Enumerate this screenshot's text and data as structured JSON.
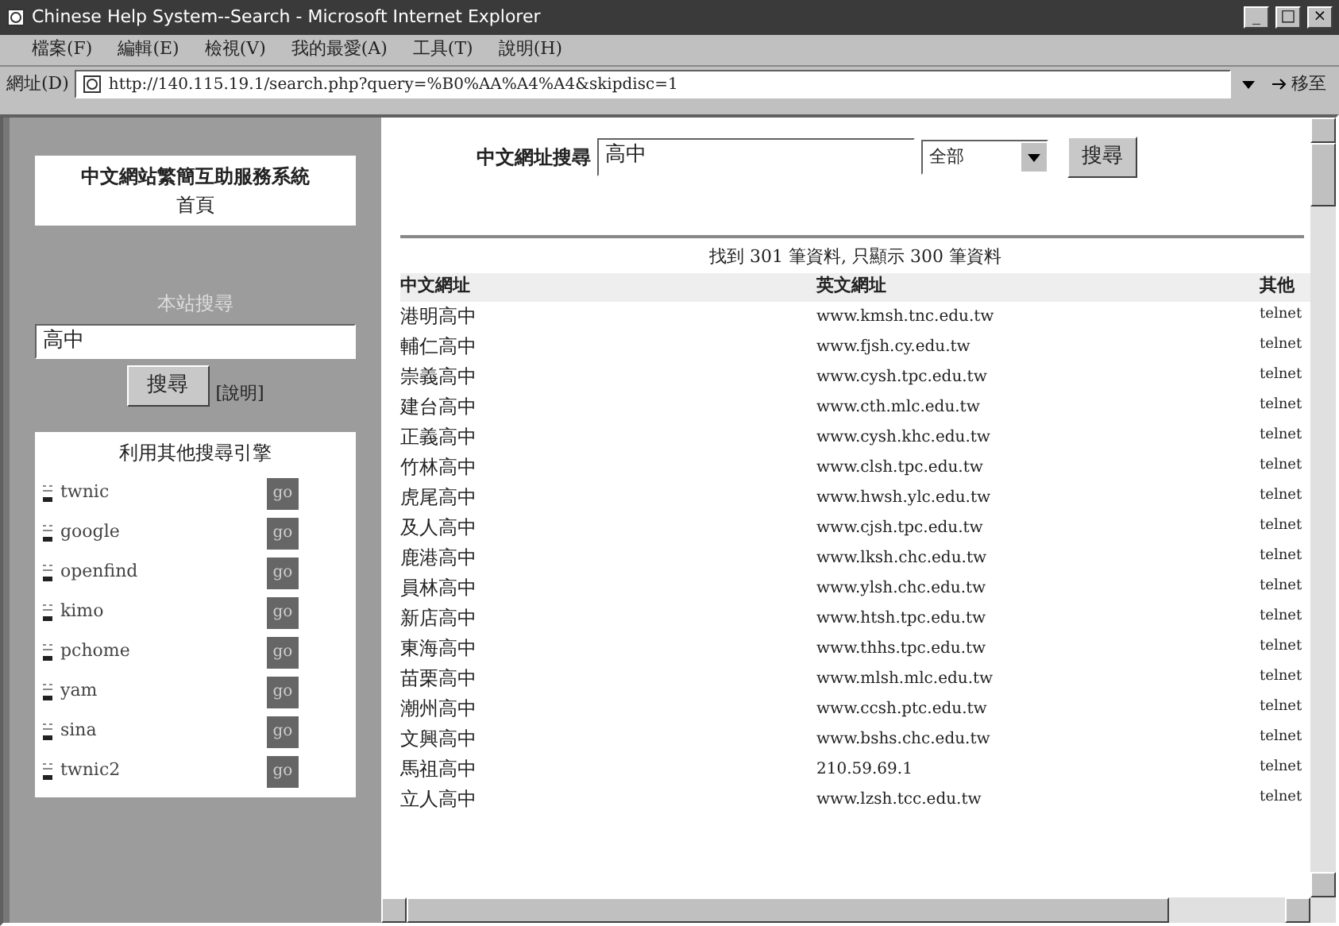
{
  "window": {
    "title": "Chinese Help System--Search - Microsoft Internet Explorer",
    "controls": [
      "_",
      "□",
      "×"
    ]
  },
  "menu": [
    "檔案(F)",
    "編輯(E)",
    "檢視(V)",
    "我的最愛(A)",
    "工具(T)",
    "說明(H)"
  ],
  "address_bar": {
    "label": "網址(D)",
    "value": "http://140.115.19.1/search.php?query=%B0%AA%A4%A4&skipdisc=1",
    "go": "移至"
  },
  "sidebar": {
    "site_title": "中文網站繁簡互助服務系統",
    "home_link": "首頁",
    "search_heading": "本站搜尋",
    "search_value": "高中",
    "search_button": "搜尋",
    "help_link": "[說明]",
    "engines_heading": "利用其他搜尋引擎",
    "engines": [
      {
        "name": "twnic",
        "go": "go"
      },
      {
        "name": "google",
        "go": "go"
      },
      {
        "name": "openfind",
        "go": "go"
      },
      {
        "name": "kimo",
        "go": "go"
      },
      {
        "name": "pchome",
        "go": "go"
      },
      {
        "name": "yam",
        "go": "go"
      },
      {
        "name": "sina",
        "go": "go"
      },
      {
        "name": "twnic2",
        "go": "go"
      }
    ]
  },
  "search": {
    "label": "中文網址搜尋",
    "value": "高中",
    "scope": "全部",
    "button": "搜尋"
  },
  "result_summary": "找到 301 筆資料, 只顯示 300 筆資料",
  "table": {
    "columns": [
      "中文網址",
      "英文網址",
      "其他"
    ],
    "rows": [
      [
        "港明高中",
        "www.kmsh.tnc.edu.tw",
        "telnet"
      ],
      [
        "輔仁高中",
        "www.fjsh.cy.edu.tw",
        "telnet"
      ],
      [
        "崇義高中",
        "www.cysh.tpc.edu.tw",
        "telnet"
      ],
      [
        "建台高中",
        "www.cth.mlc.edu.tw",
        "telnet"
      ],
      [
        "正義高中",
        "www.cysh.khc.edu.tw",
        "telnet"
      ],
      [
        "竹林高中",
        "www.clsh.tpc.edu.tw",
        "telnet"
      ],
      [
        "虎尾高中",
        "www.hwsh.ylc.edu.tw",
        "telnet"
      ],
      [
        "及人高中",
        "www.cjsh.tpc.edu.tw",
        "telnet"
      ],
      [
        "鹿港高中",
        "www.lksh.chc.edu.tw",
        "telnet"
      ],
      [
        "員林高中",
        "www.ylsh.chc.edu.tw",
        "telnet"
      ],
      [
        "新店高中",
        "www.htsh.tpc.edu.tw",
        "telnet"
      ],
      [
        "東海高中",
        "www.thhs.tpc.edu.tw",
        "telnet"
      ],
      [
        "苗栗高中",
        "www.mlsh.mlc.edu.tw",
        "telnet"
      ],
      [
        "潮州高中",
        "www.ccsh.ptc.edu.tw",
        "telnet"
      ],
      [
        "文興高中",
        "www.bshs.chc.edu.tw",
        "telnet"
      ],
      [
        "馬祖高中",
        "210.59.69.1",
        "telnet"
      ],
      [
        "立人高中",
        "www.lzsh.tcc.edu.tw",
        "telnet"
      ]
    ]
  }
}
